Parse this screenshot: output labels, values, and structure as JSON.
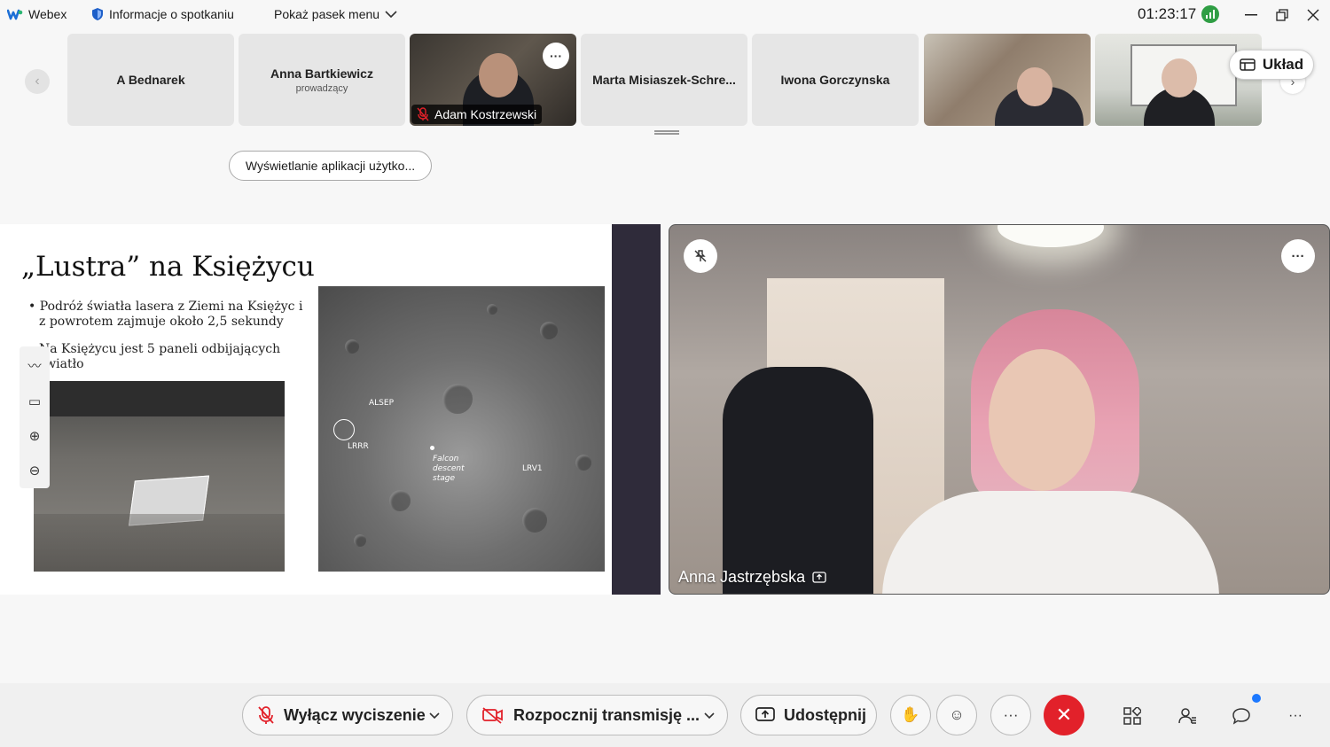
{
  "titlebar": {
    "app_name": "Webex",
    "meeting_info": "Informacje o spotkaniu",
    "menu_bar": "Pokaż pasek menu",
    "timer": "01:23:17"
  },
  "participants": [
    {
      "name": "A Bednarek",
      "role": ""
    },
    {
      "name": "Anna Bartkiewicz",
      "role": "prowadzący"
    },
    {
      "name": "Adam Kostrzewski",
      "role": ""
    },
    {
      "name": "Marta Misiaszek-Schre...",
      "role": ""
    },
    {
      "name": "Iwona Gorczynska",
      "role": ""
    }
  ],
  "layout_button": "Układ",
  "app_view_button": "Wyświetlanie aplikacji użytko...",
  "slide": {
    "title": "„Lustra” na Księżycu",
    "bullet1_line1": "Podróż światła lasera z Ziemi na Księżyc i",
    "bullet1_line2": "z powrotem zajmuje około 2,5 sekundy",
    "bullet2_line1": "Na Księżycu jest 5 paneli odbijających",
    "bullet2_line2": "światło",
    "map_labels": {
      "alsep": "ALSEP",
      "lrrr": "LRRR",
      "falcon1": "Falcon",
      "falcon2": "descent",
      "falcon3": "stage",
      "lrv1": "LRV1"
    }
  },
  "speaker": {
    "name": "Anna Jastrzębska"
  },
  "controls": {
    "mute": "Wyłącz wyciszenie",
    "video": "Rozpocznij transmisję ...",
    "share": "Udostępnij"
  },
  "colors": {
    "end_call": "#e2212a",
    "notification_dot": "#1c78ff",
    "timer_indicator": "#2f9e44"
  }
}
